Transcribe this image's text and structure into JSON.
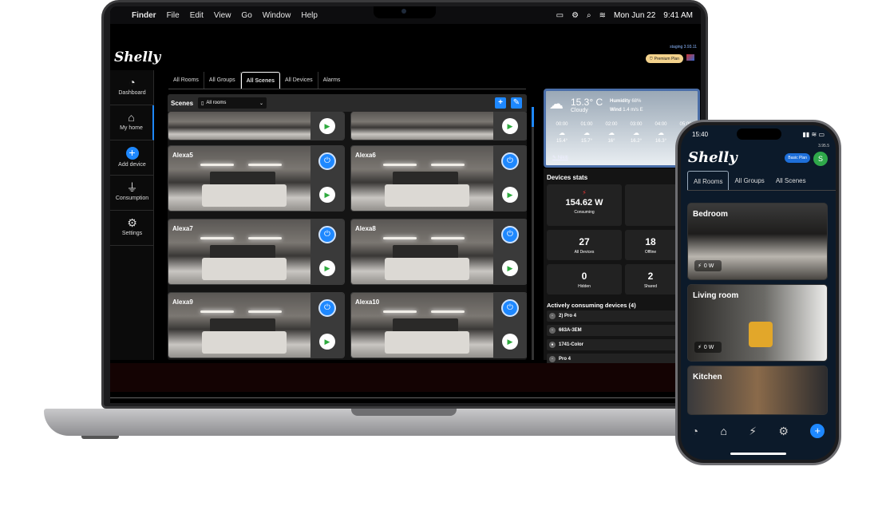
{
  "mac_menu": {
    "apple": "",
    "finder": "Finder",
    "items": [
      "File",
      "Edit",
      "View",
      "Go",
      "Window",
      "Help"
    ],
    "date": "Mon Jun 22",
    "time": "9:41 AM"
  },
  "app": {
    "logo": "Shelly",
    "version": "staging 3.93.11",
    "plan": "Premium Plan",
    "sidebar": [
      {
        "label": "Dashboard",
        "icon": "gauge-icon"
      },
      {
        "label": "My home",
        "icon": "home-icon"
      },
      {
        "label": "Add device",
        "icon": "plus-icon"
      },
      {
        "label": "Consumption",
        "icon": "plug-icon"
      },
      {
        "label": "Settings",
        "icon": "gear-icon"
      }
    ],
    "tabs": [
      "All Rooms",
      "All Groups",
      "All Scenes",
      "All Devices",
      "Alarms"
    ],
    "active_tab": "All Scenes",
    "scenes": {
      "title": "Scenes",
      "room_filter": "All rooms",
      "cards": [
        "Alexa5",
        "Alexa6",
        "Alexa7",
        "Alexa8",
        "Alexa9",
        "Alexa10"
      ]
    },
    "weather": {
      "temp": "15.3° C",
      "condition": "Cloudy",
      "humidity_label": "Humidity",
      "humidity": "68%",
      "wind_label": "Wind",
      "wind": "1.4 m/s E",
      "hours": [
        {
          "t": "00:00",
          "v": "15.4°"
        },
        {
          "t": "01:00",
          "v": "15.7°"
        },
        {
          "t": "02:00",
          "v": "16°"
        },
        {
          "t": "03:00",
          "v": "16.2°"
        },
        {
          "t": "04:00",
          "v": "16.3°"
        },
        {
          "t": "05:00",
          "v": "16°"
        }
      ],
      "location": "Nikiti"
    },
    "stats": {
      "title": "Devices stats",
      "consumption": "154.62 W",
      "consumption_label": "Consuming",
      "all": "27",
      "all_label": "All Devices",
      "offline": "18",
      "offline_label": "Offline",
      "hidden": "0",
      "hidden_label": "Hidden",
      "shared": "2",
      "shared_label": "Shared"
    },
    "active": {
      "title": "Actively consuming devices (4)",
      "devices": [
        "2) Pro 4",
        "663A-3EM",
        "1741-Color",
        "Pro 4"
      ]
    }
  },
  "phone": {
    "time": "15:40",
    "logo": "Shelly",
    "version": "3.95.5",
    "plan": "Basic Plan",
    "avatar": "S",
    "tabs": [
      "All Rooms",
      "All Groups",
      "All Scenes"
    ],
    "rooms": [
      {
        "name": "Bedroom",
        "power": "0 W"
      },
      {
        "name": "Living room",
        "power": "0 W"
      },
      {
        "name": "Kitchen",
        "power": ""
      }
    ]
  }
}
